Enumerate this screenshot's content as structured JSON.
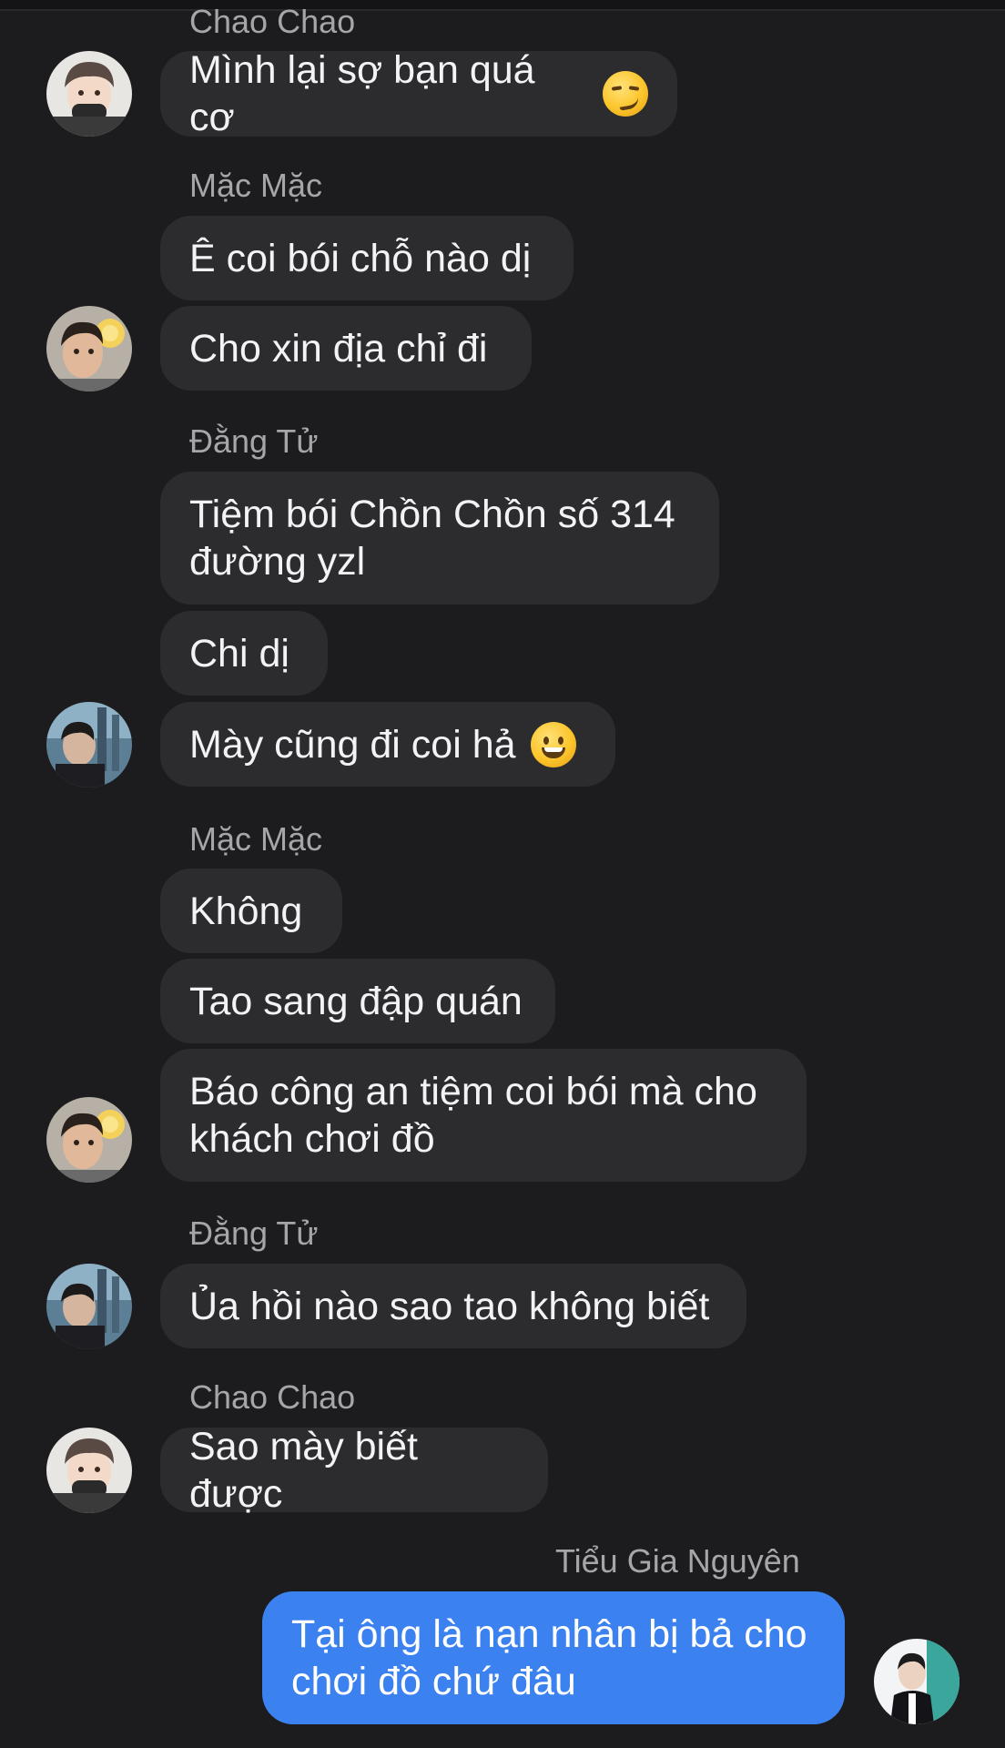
{
  "conversation": {
    "names": {
      "chao_chao_1": "Chao Chao",
      "mac_mac_1": "Mặc Mặc",
      "dang_tu_1": "Đằng Tử",
      "mac_mac_2": "Mặc Mặc",
      "dang_tu_2": "Đằng Tử",
      "chao_chao_2": "Chao Chao",
      "tieu_gia_nguyen": "Tiểu Gia Nguyên"
    },
    "messages": {
      "m1": "Mình lại sợ bạn quá cơ",
      "m2": "Ê coi bói chỗ nào dị",
      "m3": "Cho xin địa chỉ đi",
      "m4": "Tiệm bói Chồn Chồn số 314\nđường yzl",
      "m5": "Chi dị",
      "m6": "Mày cũng đi coi hả",
      "m7": "Không",
      "m8": "Tao sang đập quán",
      "m9": "Báo công an tiệm coi bói mà cho\nkhách chơi đồ",
      "m10": "Ủa hồi nào sao tao không biết",
      "m11": "Sao mày biết được",
      "m12": "Tại ông là nạn nhân bị bả cho\nchơi đồ chứ đâu"
    },
    "emojis": {
      "m1": "smirking-face-emoji",
      "m6": "grinning-face-emoji"
    }
  },
  "colors": {
    "background": "#1c1c1e",
    "incoming_bubble": "#2c2c2e",
    "outgoing_bubble": "#3b82f0",
    "sender_name": "#a5a5aa",
    "message_text": "#f2f2f7"
  }
}
